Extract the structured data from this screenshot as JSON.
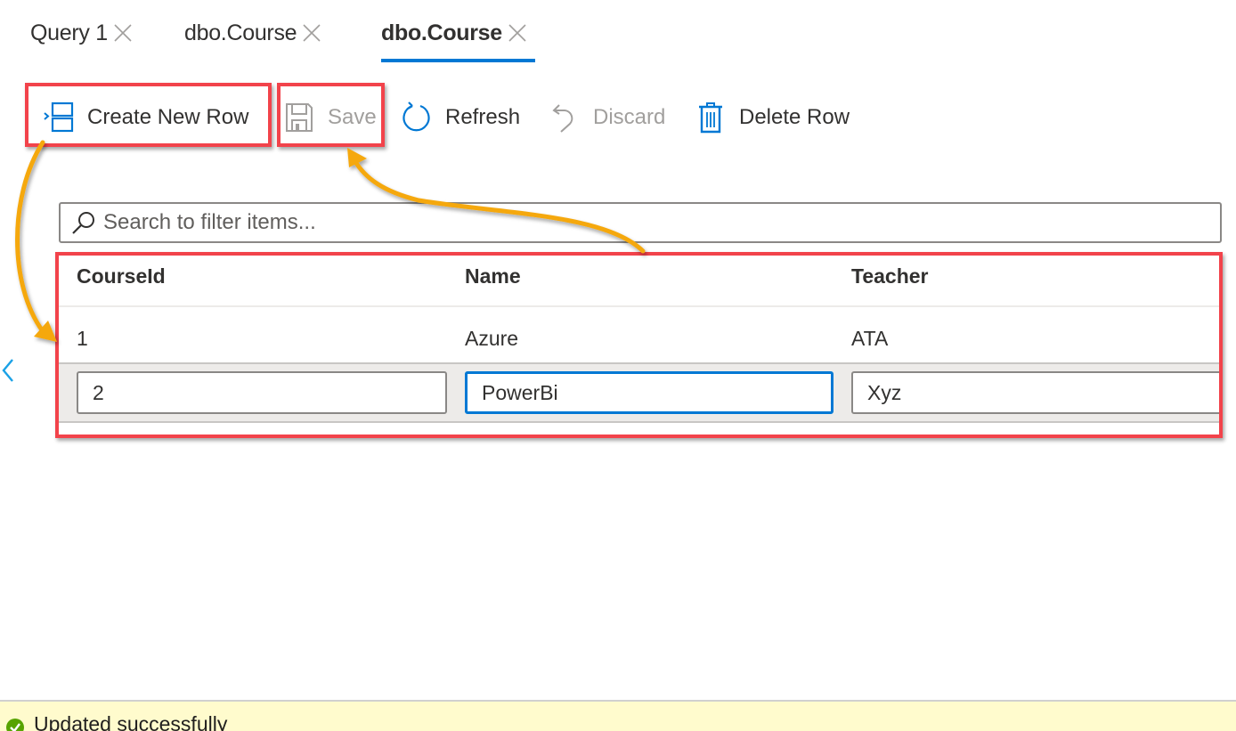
{
  "tabs": [
    {
      "label": "Query 1",
      "active": false
    },
    {
      "label": "dbo.Course",
      "active": false
    },
    {
      "label": "dbo.Course",
      "active": true
    }
  ],
  "toolbar": {
    "create_label": "Create New Row",
    "save_label": "Save",
    "refresh_label": "Refresh",
    "discard_label": "Discard",
    "delete_label": "Delete Row"
  },
  "search": {
    "placeholder": "Search to filter items...",
    "value": ""
  },
  "grid": {
    "columns": [
      "CourseId",
      "Name",
      "Teacher"
    ],
    "rows": [
      [
        "1",
        "Azure",
        "ATA"
      ]
    ],
    "edit_row": [
      "2",
      "PowerBi",
      "Xyz"
    ]
  },
  "status": {
    "text": "Updated successfully"
  },
  "colors": {
    "accent": "#0078d4",
    "highlight": "#f2434b",
    "arrow": "#f5a80f",
    "status_bg": "#fffbcd",
    "success": "#57a300"
  }
}
